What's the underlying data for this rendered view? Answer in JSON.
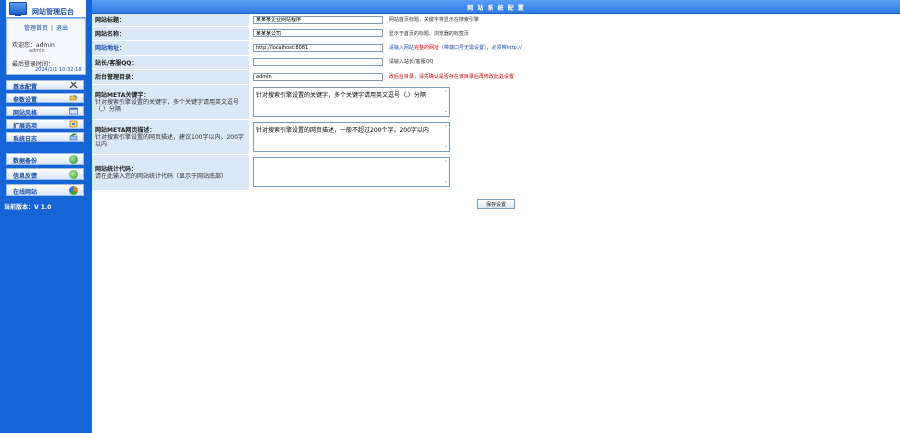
{
  "sidebar": {
    "logo_text": "网站管理后台",
    "user_links": [
      "管理首页",
      "退出"
    ],
    "username_label": "欢迎您：admin",
    "username": "admin",
    "last_login_label": "最后登录时间：",
    "last_login_time": "2024/1/1 10:32:18",
    "menu": [
      {
        "label": "基本配置",
        "icon": "tools-icon"
      },
      {
        "label": "参数设置",
        "icon": "pencil-icon"
      },
      {
        "label": "网站风格",
        "icon": "window-icon"
      },
      {
        "label": "扩展选项",
        "icon": "box-icon"
      },
      {
        "label": "系统日志",
        "icon": "log-icon"
      }
    ],
    "menu2": [
      {
        "label": "数据备份",
        "icon": "globe-icon",
        "color": "#3aa63a"
      },
      {
        "label": "信息反馈",
        "icon": "people-icon",
        "color": "#2f9a2f"
      },
      {
        "label": "在线网站",
        "icon": "recycle-icon",
        "color": "#e0861a"
      }
    ],
    "version": "当前版本：V 1.0"
  },
  "header": {
    "title": "网 站 系 统 配 置"
  },
  "form": {
    "site_title": {
      "label": "网站标题：",
      "value": "某某某企业网站程序",
      "hint": "网站首页标题，关键字将显示在搜索引擎"
    },
    "site_name": {
      "label": "网站名称：",
      "value": "某某某公司",
      "hint": "显示于首页的标题、浏览器的标签页"
    },
    "site_url": {
      "label": "网站地址：",
      "value": "http://localhost:8081",
      "hint_prefix": "请输入网站",
      "hint_red": "完整的网址",
      "hint_mid": "（带端口号无需设置），",
      "hint_suffix": "必须带http://"
    },
    "webmaster_qq": {
      "label": "站长/客服QQ：",
      "value": "",
      "hint": "请输入站长/客服QQ"
    },
    "admin_dir": {
      "label": "后台管理目录：",
      "value": "admin",
      "hint": "改后台目录，请先确认是否存在该目录后再修改此处设置"
    },
    "keywords": {
      "label": "网站META关键字：",
      "sub": "针对搜索引擎设置的关键字，多个关键字请用英文逗号（,）分隔",
      "value": "针对搜索引擎设置的关键字，多个关键字请用英文逗号（,）分隔"
    },
    "description": {
      "label": "网站META网页描述：",
      "sub": "针对搜索引擎设置的网页描述，建议100字以内，200字以内",
      "value": "针对搜索引擎设置的网页描述，一般不超过200个字，200字以内"
    },
    "stats_code": {
      "label": "网站统计代码：",
      "sub": "请在此输入您的网站统计代码（显示于网站底部）",
      "value": ""
    }
  },
  "save_label": "保存设置"
}
